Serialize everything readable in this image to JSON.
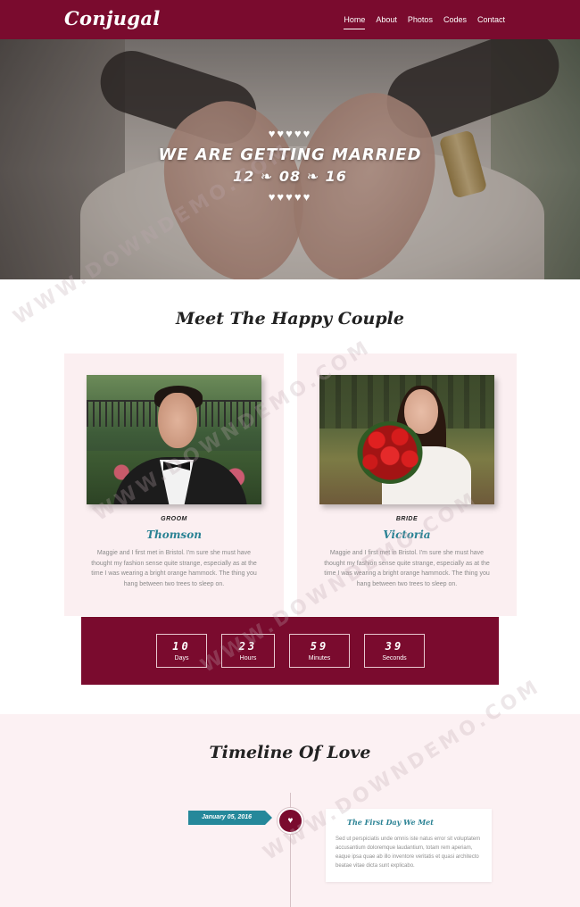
{
  "brand": "Conjugal",
  "nav": {
    "items": [
      "Home",
      "About",
      "Photos",
      "Codes",
      "Contact"
    ],
    "active": "Home"
  },
  "hero": {
    "hearts": "♥♥♥♥♥",
    "title": "WE ARE GETTING MARRIED",
    "date": "12 ❧ 08 ❧ 16"
  },
  "couple": {
    "title": "Meet The Happy Couple",
    "groom": {
      "role": "GROOM",
      "name": "Thomson",
      "description": "Maggie and I first met in Bristol. I'm sure she must have thought my fashion sense quite strange, especially as at the time I was wearing a bright orange hammock. The thing you hang between two trees to sleep on."
    },
    "bride": {
      "role": "BRIDE",
      "name": "Victoria",
      "description": "Maggie and I first met in Bristol. I'm sure she must have thought my fashion sense quite strange, especially as at the time I was wearing a bright orange hammock. The thing you hang between two trees to sleep on."
    }
  },
  "countdown": [
    {
      "value": "10",
      "label": "Days"
    },
    {
      "value": "23",
      "label": "Hours"
    },
    {
      "value": "59",
      "label": "Minutes"
    },
    {
      "value": "39",
      "label": "Seconds"
    }
  ],
  "timeline": {
    "title": "Timeline Of Love",
    "events": [
      {
        "date": "January 05, 2016",
        "title": "The First Day We Met",
        "text": "Sed ut perspiciatis unde omnis iste natus error sit voluptatem accusantium doloremque laudantium, totam rem aperiam, eaque ipsa quae ab illo inventore veritatis et quasi architecto beatae vitae dicta sunt explicabo."
      }
    ]
  },
  "watermark": "WWW.DOWNDEMO.COM",
  "colors": {
    "primary": "#7a0b2e",
    "accent": "#2a8294",
    "card_bg": "#fbeff1"
  }
}
